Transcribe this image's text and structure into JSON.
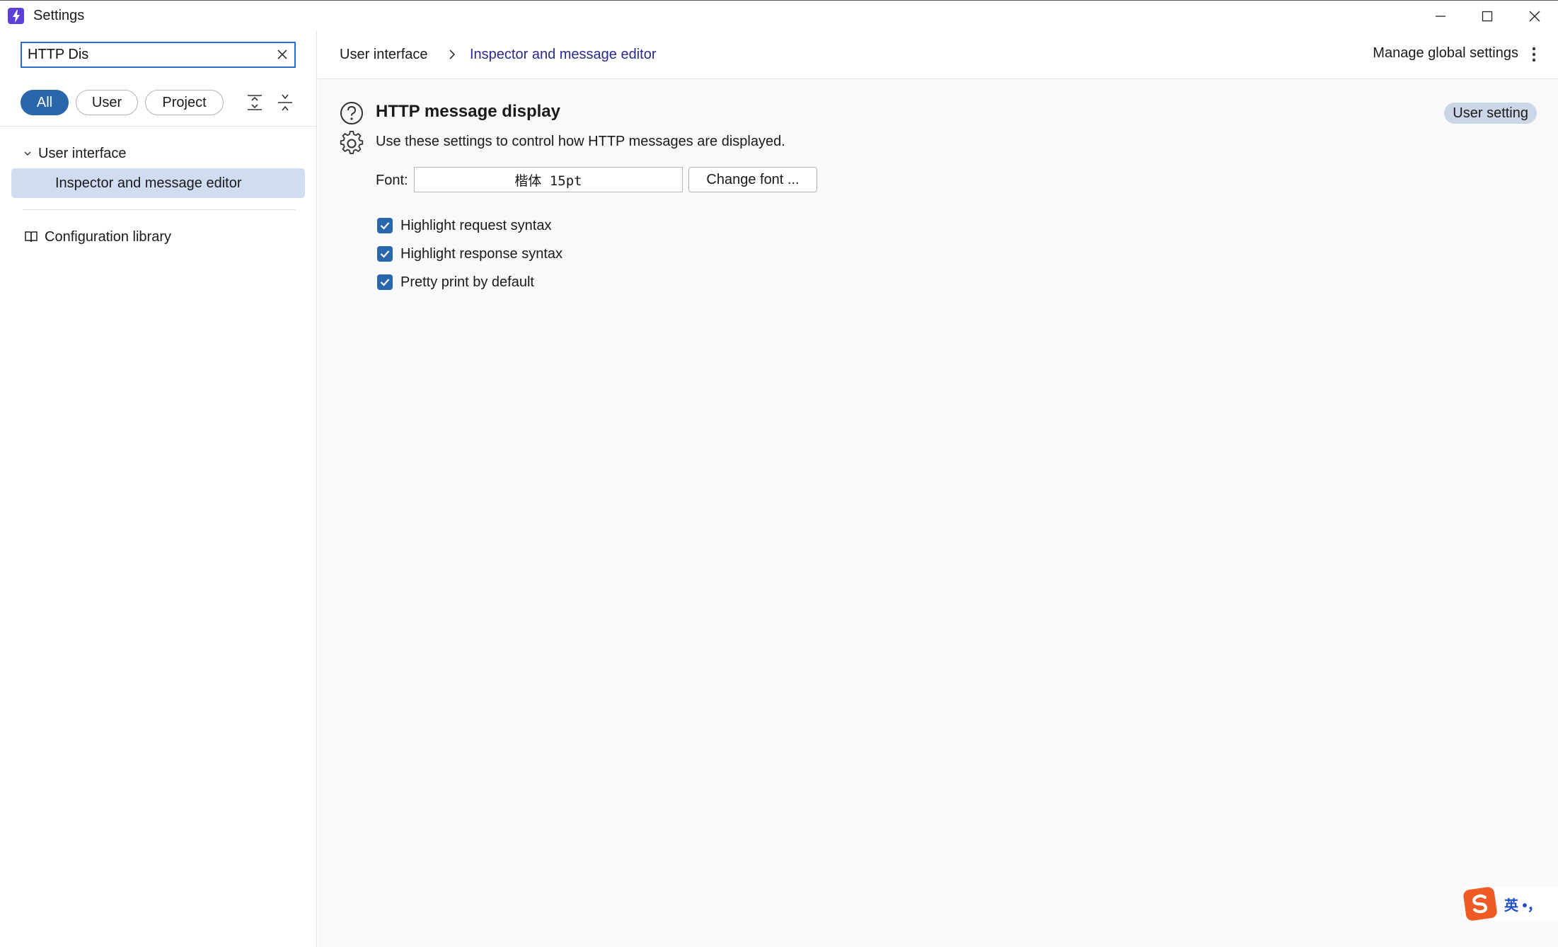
{
  "window": {
    "title": "Settings",
    "app_icon": "lightning-icon",
    "controls": [
      "minimize-icon",
      "maximize-icon",
      "close-icon"
    ]
  },
  "sidebar": {
    "search": {
      "value": "HTTP Dis",
      "placeholder": ""
    },
    "filters": [
      {
        "label": "All",
        "active": true
      },
      {
        "label": "User",
        "active": false
      },
      {
        "label": "Project",
        "active": false
      }
    ],
    "tree": {
      "parent_label": "User interface",
      "child_label": "Inspector and message editor"
    },
    "config_library_label": "Configuration library"
  },
  "header": {
    "breadcrumb": [
      "User interface",
      "Inspector and message editor"
    ],
    "manage_label": "Manage global settings"
  },
  "section": {
    "title": "HTTP message display",
    "description": "Use these settings to control how HTTP messages are displayed.",
    "badge": "User setting",
    "font_label": "Font:",
    "font_value": "楷体 15pt",
    "change_font_label": "Change font ...",
    "options": [
      {
        "label": "Highlight request syntax",
        "checked": true
      },
      {
        "label": "Highlight response syntax",
        "checked": true
      },
      {
        "label": "Pretty print by default",
        "checked": true
      }
    ]
  },
  "ime": {
    "label": "英 •，"
  },
  "colors": {
    "accent": "#2a66ac",
    "selection": "#cfdcf2",
    "link": "#2a2a8c",
    "badge": "#cbd6e6"
  }
}
